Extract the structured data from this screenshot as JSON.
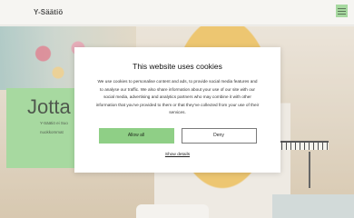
{
  "header": {
    "logo": "Y-Säätiö",
    "menu_icon": "hamburger-menu-icon"
  },
  "hero": {
    "title": "Jotta j",
    "lines": [
      "Y-Säätiö ei Suo",
      "nuokkommat"
    ]
  },
  "cookie_banner": {
    "title": "This website uses cookies",
    "body": "We use cookies to personalise content and ads, to provide social media features and to analyse our traffic. We also share information about your use of our site with our social media, advertising and analytics partners who may combine it with other information that you’ve provided to them or that they’ve collected from your use of their services.",
    "allow_label": "Allow all",
    "deny_label": "Deny",
    "details_label": "Show details"
  },
  "colors": {
    "accent": "#8fcf86",
    "header_bg": "#f4f3ef",
    "modal_bg": "#ffffff"
  }
}
